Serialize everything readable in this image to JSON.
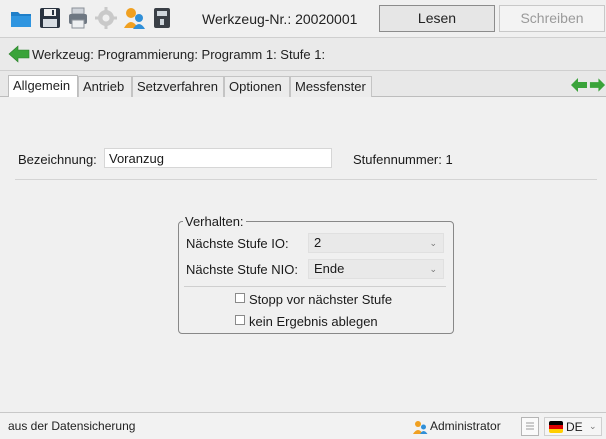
{
  "toolbar": {
    "tool_number": "Werkzeug-Nr.: 20020001",
    "read_button": "Lesen",
    "write_button": "Schreiben",
    "icons": [
      "folder-icon",
      "save-icon",
      "print-icon",
      "settings-icon",
      "user-icon",
      "device-icon"
    ]
  },
  "breadcrumb": {
    "text": "Werkzeug: Programmierung: Programm 1: Stufe 1:"
  },
  "tabs": [
    {
      "label": "Allgemein",
      "active": true
    },
    {
      "label": "Antrieb",
      "active": false
    },
    {
      "label": "Setzverfahren",
      "active": false
    },
    {
      "label": "Optionen",
      "active": false
    },
    {
      "label": "Messfenster",
      "active": false
    }
  ],
  "form": {
    "name_label": "Bezeichnung:",
    "name_value": "Voranzug",
    "stage_number_label": "Stufennummer: 1"
  },
  "behavior": {
    "title": "Verhalten:",
    "next_io_label": "Nächste Stufe IO:",
    "next_io_value": "2",
    "next_nio_label": "Nächste Stufe NIO:",
    "next_nio_value": "Ende",
    "stop_label": "Stopp vor nächster Stufe",
    "stop_checked": false,
    "no_result_label": "kein Ergebnis ablegen",
    "no_result_checked": false
  },
  "statusbar": {
    "message": "aus der Datensicherung",
    "user": "Administrator",
    "language": "DE"
  },
  "colors": {
    "accent_blue": "#2f8fd8",
    "arrow_green": "#3aa33a",
    "user_orange": "#f0a020"
  }
}
